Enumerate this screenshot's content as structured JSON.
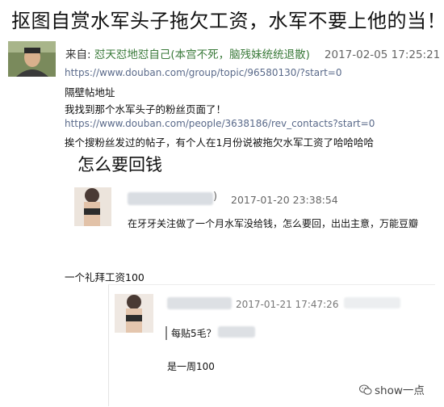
{
  "post": {
    "title": "抠图自赏水军头子拖欠工资，水军不要上他的当！",
    "from_label": "来自: ",
    "author": "怼天怼地怼自己(本宫不死，脑残妹统统退散)",
    "timestamp": "2017-02-05 17:25:21",
    "lines": [
      {
        "kind": "link",
        "text": "https://www.douban.com/group/topic/96580130/?start=0"
      },
      {
        "kind": "text",
        "text": "隔壁帖地址"
      },
      {
        "kind": "text",
        "text": "我找到那个水军头子的粉丝页面了！"
      },
      {
        "kind": "link",
        "text": "https://www.douban.com/people/3638186/rev_contacts?start=0"
      },
      {
        "kind": "text",
        "text": "挨个搜粉丝发过的帖子，有个人在1月份说被拖欠水军工资了哈哈哈哈"
      }
    ]
  },
  "quoted_post": {
    "title": "怎么要回钱",
    "close_paren": ")",
    "timestamp": "2017-01-20 23:38:54",
    "text": "在牙牙关注做了一个月水军没给钱，怎么要回，出出主意，万能豆瓣"
  },
  "weekly_label": "一个礼拜工资100",
  "nested_reply": {
    "timestamp": "2017-01-21 17:47:26",
    "quote": "每贴5毛？",
    "text": "是一周100"
  },
  "watermark": {
    "text": "show一点",
    "icon": "wechat-icon"
  }
}
